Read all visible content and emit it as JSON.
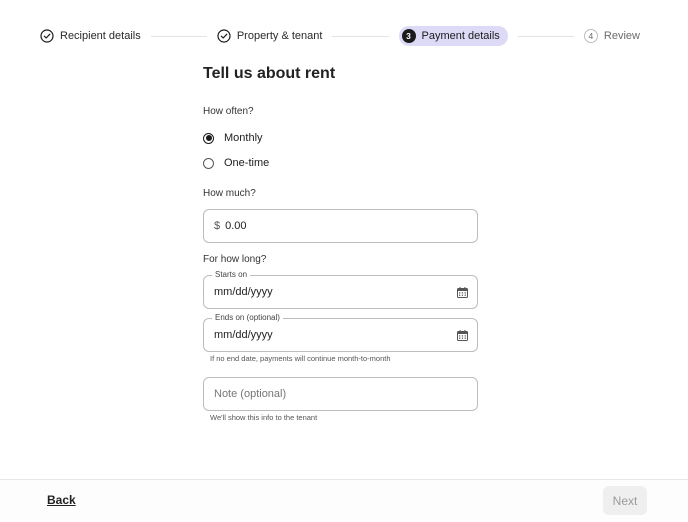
{
  "stepper": {
    "steps": [
      {
        "number": "1",
        "label": "Recipient details",
        "state": "complete",
        "icon": "check-circle-icon"
      },
      {
        "number": "2",
        "label": "Property & tenant",
        "state": "complete",
        "icon": "check-circle-icon"
      },
      {
        "number": "3",
        "label": "Payment details",
        "state": "active"
      },
      {
        "number": "4",
        "label": "Review",
        "state": "upcoming"
      }
    ],
    "active_color": "#dcdaf6"
  },
  "form": {
    "title": "Tell us about rent",
    "frequency": {
      "label": "How often?",
      "options": [
        {
          "label": "Monthly",
          "selected": true
        },
        {
          "label": "One-time",
          "selected": false
        }
      ]
    },
    "amount": {
      "label": "How much?",
      "currency_symbol": "$",
      "value": "0.00"
    },
    "duration": {
      "label": "For how long?",
      "starts_on": {
        "legend": "Starts on",
        "placeholder": "mm/dd/yyyy",
        "icon": "calendar-icon"
      },
      "ends_on": {
        "legend": "Ends on (optional)",
        "placeholder": "mm/dd/yyyy",
        "icon": "calendar-icon"
      },
      "hint": "If no end date, payments will continue month-to-month"
    },
    "note": {
      "placeholder": "Note (optional)",
      "hint": "We'll show this info to the tenant"
    }
  },
  "footer": {
    "back_label": "Back",
    "next_label": "Next",
    "next_enabled": false
  }
}
